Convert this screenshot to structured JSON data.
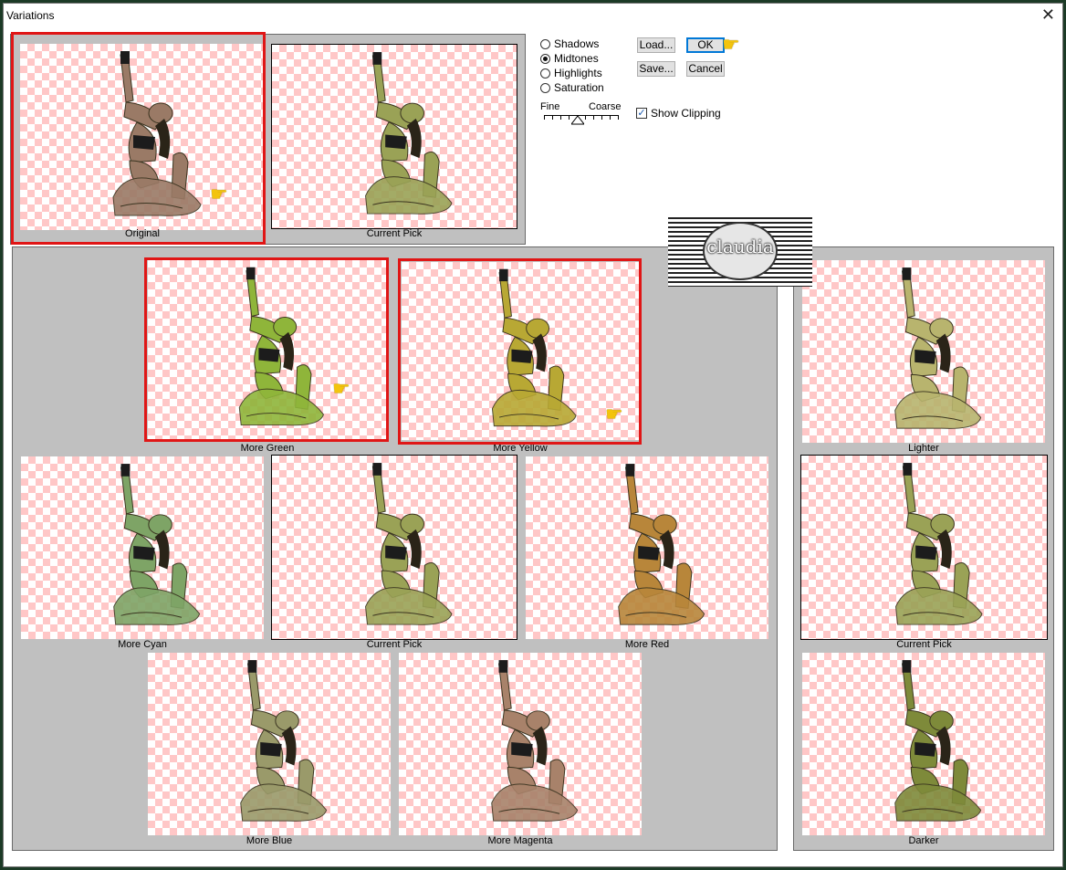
{
  "window": {
    "title": "Variations",
    "close_glyph": "✕"
  },
  "tones": {
    "options": [
      "Shadows",
      "Midtones",
      "Highlights",
      "Saturation"
    ],
    "selected": "Midtones"
  },
  "slider": {
    "fine_label": "Fine",
    "coarse_label": "Coarse",
    "position": 0.45
  },
  "buttons": {
    "load": "Load...",
    "save": "Save...",
    "ok": "OK",
    "cancel": "Cancel"
  },
  "show_clipping": {
    "label": "Show Clipping",
    "checked": true
  },
  "watermark": {
    "text": "claudia"
  },
  "top_previews": {
    "original": "Original",
    "current_pick": "Current Pick"
  },
  "color_grid": {
    "more_green": "More Green",
    "more_yellow": "More Yellow",
    "more_cyan": "More Cyan",
    "current_pick": "Current Pick",
    "more_red": "More Red",
    "more_blue": "More Blue",
    "more_magenta": "More Magenta"
  },
  "brightness": {
    "lighter": "Lighter",
    "current_pick": "Current Pick",
    "darker": "Darker"
  },
  "tints": {
    "original": "#9a7a66",
    "current_pick": "#9aa256",
    "more_green": "#8fb53a",
    "more_yellow": "#b8a834",
    "more_cyan": "#7ea466",
    "more_red": "#b8863a",
    "more_blue": "#9a9a6a",
    "more_magenta": "#a8826a",
    "lighter": "#b8b46e",
    "darker": "#7e8a3a",
    "hair": "#2a2418",
    "top": "#1c1c1c"
  }
}
